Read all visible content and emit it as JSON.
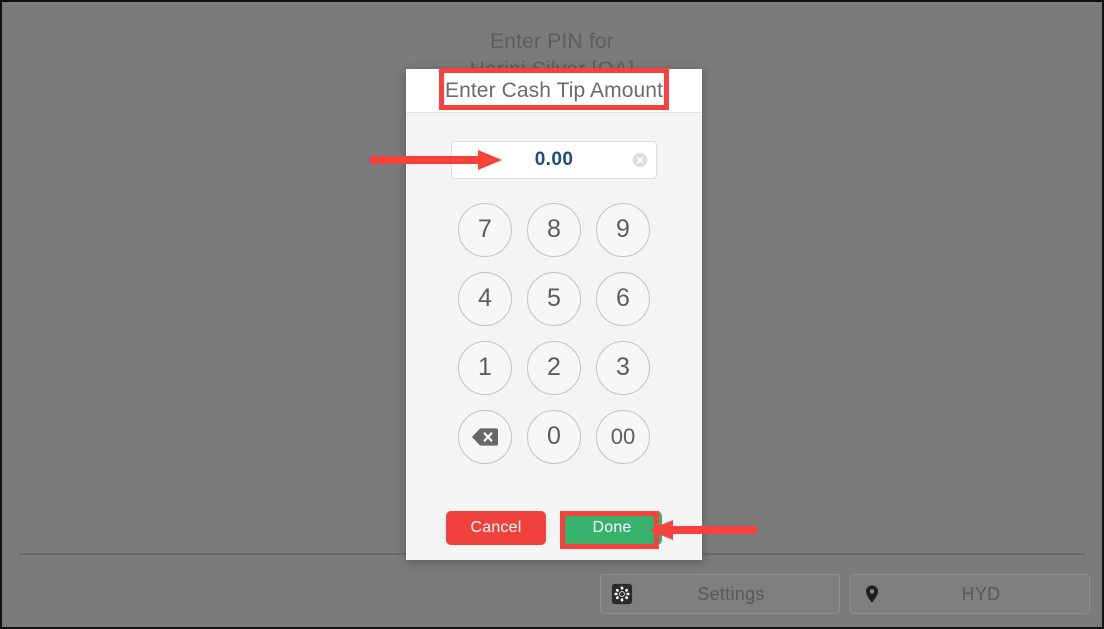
{
  "background": {
    "prompt_line1": "Enter PIN for",
    "prompt_line2": "Harini Silver [QA]"
  },
  "bottom_bar": {
    "settings_label": "Settings",
    "settings_icon": "gear-icon",
    "location_label": "HYD",
    "location_icon": "map-pin-icon"
  },
  "modal": {
    "title": "Enter Cash Tip Amount",
    "amount_value": "0.00",
    "amount_placeholder": "0.00",
    "clear_icon": "clear-circle-icon",
    "keypad": [
      {
        "label": "7",
        "name": "key-7"
      },
      {
        "label": "8",
        "name": "key-8"
      },
      {
        "label": "9",
        "name": "key-9"
      },
      {
        "label": "4",
        "name": "key-4"
      },
      {
        "label": "5",
        "name": "key-5"
      },
      {
        "label": "6",
        "name": "key-6"
      },
      {
        "label": "1",
        "name": "key-1"
      },
      {
        "label": "2",
        "name": "key-2"
      },
      {
        "label": "3",
        "name": "key-3"
      },
      {
        "label": "",
        "name": "key-backspace"
      },
      {
        "label": "0",
        "name": "key-0"
      },
      {
        "label": "00",
        "name": "key-00"
      }
    ],
    "cancel_label": "Cancel",
    "done_label": "Done"
  },
  "colors": {
    "cancel_red": "#f0413c",
    "done_green": "#37b26c",
    "highlight_red": "#f6413c",
    "amount_blue": "#1a4d84",
    "backdrop_gray": "#7b7b7b"
  },
  "annotations": {
    "highlight_title": "Enter Cash Tip Amount",
    "highlight_done": "Done",
    "arrow_to_amount_field": "points right at the amount input field",
    "arrow_to_done_button": "points left at the Done button"
  }
}
